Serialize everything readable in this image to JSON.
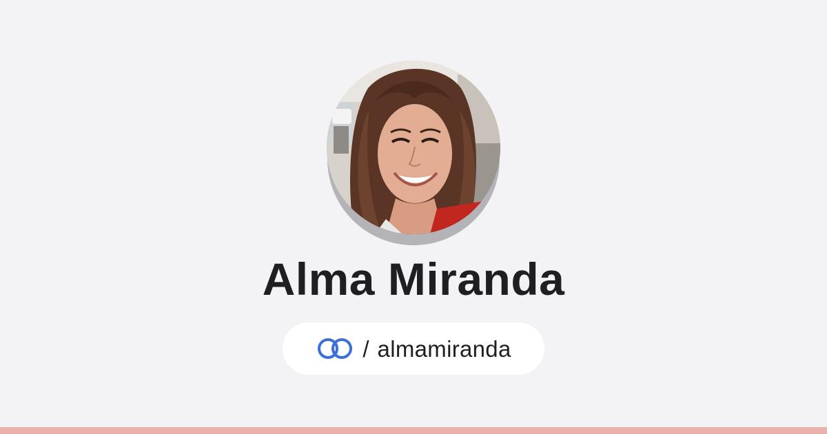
{
  "profile": {
    "name": "Alma Miranda",
    "separator": "/",
    "handle": "almamiranda",
    "avatar_icon": "profile-photo"
  },
  "brand": {
    "icon": "linked-circles-icon",
    "color": "#3a6fd8"
  },
  "theme": {
    "background": "#f3f3f6",
    "pill_background": "#ffffff",
    "accent_bar": "#e8b1ab",
    "text": "#1f1f22"
  }
}
